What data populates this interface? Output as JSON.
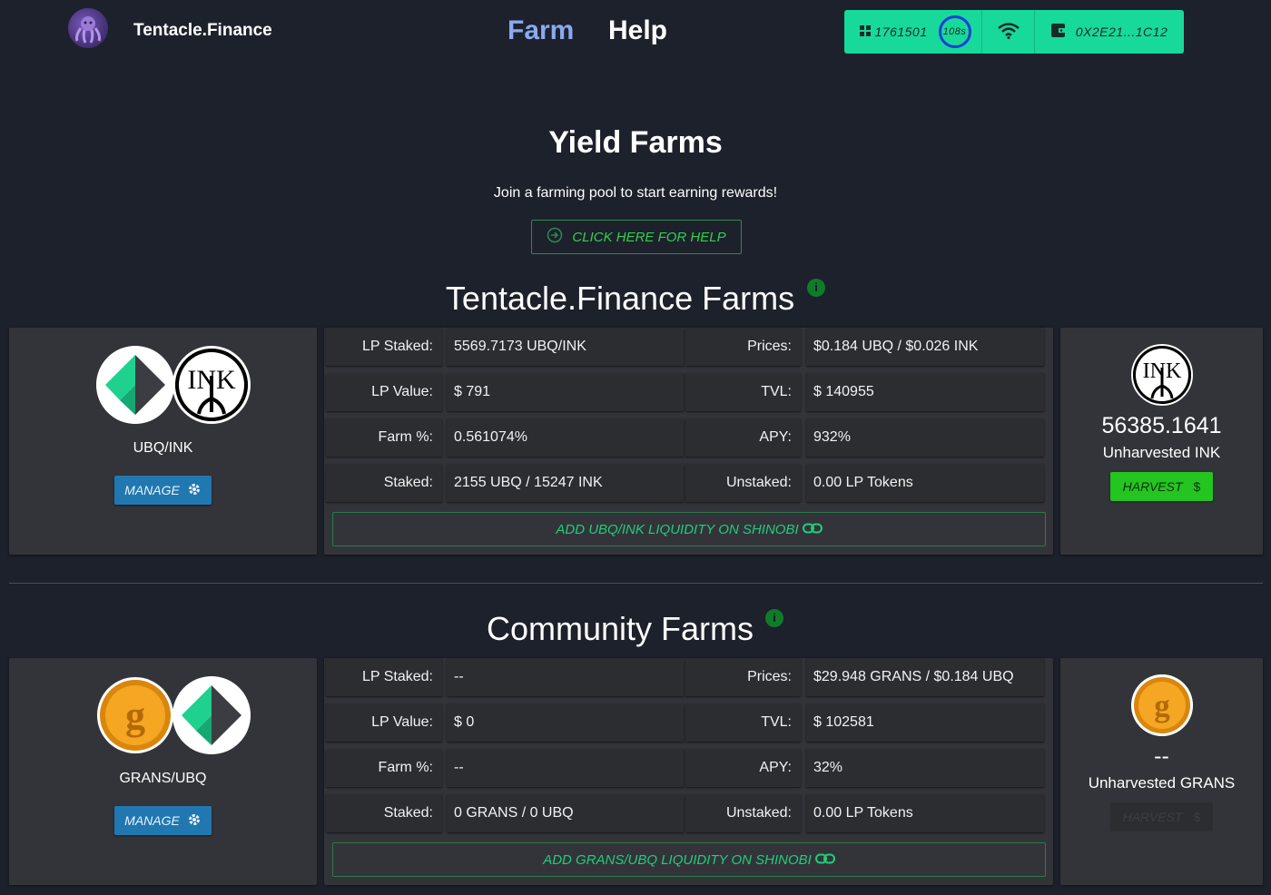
{
  "nav": {
    "brand": "Tentacle.Finance",
    "links": [
      "Farm",
      "Help"
    ],
    "block_number": "1761501",
    "countdown": "108s",
    "wallet": "0X2E21...1C12"
  },
  "hero": {
    "title": "Yield Farms",
    "subtitle": "Join a farming pool to start earning rewards!",
    "help_button": "CLICK HERE FOR HELP"
  },
  "sections": {
    "tentacle_title": "Tentacle.Finance Farms",
    "community_title": "Community Farms",
    "info_glyph": "i"
  },
  "labels": {
    "lp_staked": "LP Staked:",
    "prices": "Prices:",
    "lp_value": "LP Value:",
    "tvl": "TVL:",
    "farm_pct": "Farm %:",
    "apy": "APY:",
    "staked": "Staked:",
    "unstaked": "Unstaked:",
    "manage": "MANAGE",
    "harvest": "HARVEST",
    "dollar": "$"
  },
  "farms": [
    {
      "pair": "UBQ/INK",
      "lp_staked": "5569.7173 UBQ/INK",
      "prices": "$0.184 UBQ / $0.026 INK",
      "lp_value": "$ 791",
      "tvl": "$ 140955",
      "farm_pct": "0.561074%",
      "apy": "932%",
      "staked": "2155 UBQ / 15247 INK",
      "unstaked": "0.00 LP Tokens",
      "add_liquidity": "ADD UBQ/INK LIQUIDITY ON SHINOBI",
      "unharvested_amount": "56385.1641",
      "unharvested_label": "Unharvested INK",
      "harvest_enabled": true
    },
    {
      "pair": "GRANS/UBQ",
      "lp_staked": "--",
      "prices": "$29.948 GRANS / $0.184 UBQ",
      "lp_value": "$ 0",
      "tvl": "$ 102581",
      "farm_pct": "--",
      "apy": "32%",
      "staked": "0 GRANS / 0 UBQ",
      "unstaked": "0.00 LP Tokens",
      "add_liquidity": "ADD GRANS/UBQ LIQUIDITY ON SHINOBI",
      "unharvested_amount": "--",
      "unharvested_label": "Unharvested GRANS",
      "harvest_enabled": false
    }
  ],
  "colors": {
    "background": "#1d212b",
    "accent_green": "#17d99a",
    "nav_active": "#8aa9f0",
    "manage_blue": "#2178b0",
    "harvest_green": "#24c421"
  },
  "icons": [
    "octopus-logo-icon",
    "grid-icon",
    "wifi-icon",
    "wallet-icon",
    "arrow-circle-icon",
    "info-icon",
    "gear-icon",
    "link-icon",
    "ubq-token-icon",
    "ink-token-icon",
    "grans-token-icon"
  ]
}
